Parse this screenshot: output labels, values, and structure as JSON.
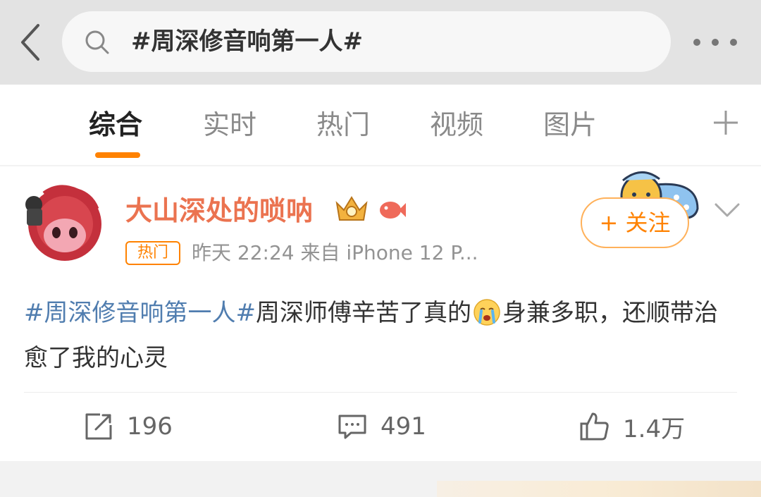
{
  "search": {
    "query": "#周深修音响第一人#"
  },
  "tabs": [
    {
      "label": "综合",
      "active": true
    },
    {
      "label": "实时"
    },
    {
      "label": "热门"
    },
    {
      "label": "视频"
    },
    {
      "label": "图片"
    }
  ],
  "post": {
    "username": "大山深处的唢呐",
    "hot_tag": "热门",
    "meta": "昨天 22:24   来自 iPhone 12 P...",
    "follow_label": "+ 关注",
    "topic": "#周深修音响第一人#",
    "text_before_emoji": "周深师傅辛苦了真的",
    "text_after_emoji": "身兼多职，还顺带治愈了我的心灵",
    "reposts": "196",
    "comments": "491",
    "likes": "1.4万"
  },
  "colors": {
    "accent": "#ff8200",
    "username": "#eb7350",
    "topic": "#507daf"
  }
}
